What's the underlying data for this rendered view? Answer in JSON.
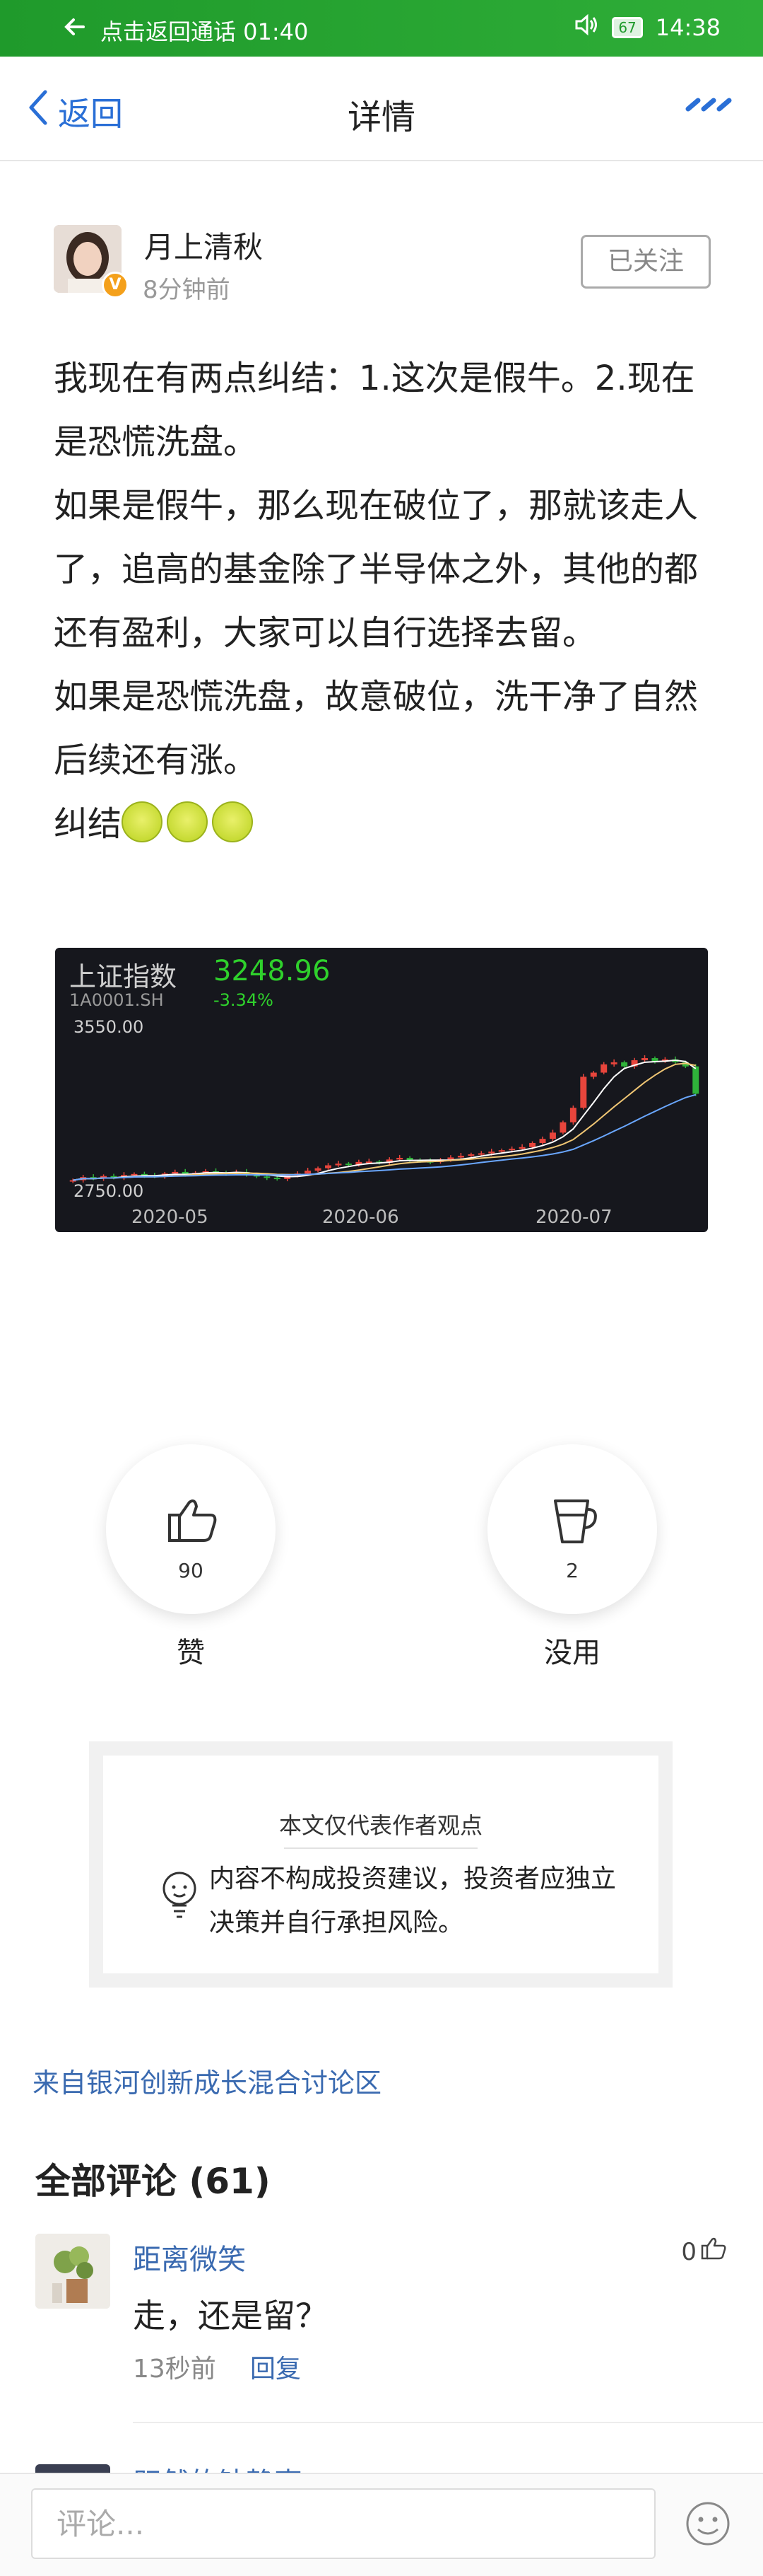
{
  "status_bar": {
    "call_text": "点击返回通话 01:40",
    "battery": "67",
    "time": "14:38"
  },
  "nav": {
    "back_label": "返回",
    "title": "详情"
  },
  "author": {
    "name": "月上清秋",
    "time": "8分钟前",
    "follow_label": "已关注",
    "badge": "V"
  },
  "article": {
    "paragraphs": [
      "我现在有两点纠结：1.这次是假牛。2.现在是恐慌洗盘。",
      "如果是假牛，那么现在破位了，那就该走人了，追高的基金除了半导体之外，其他的都还有盈利，大家可以自行选择去留。",
      "如果是恐慌洗盘，故意破位，洗干净了自然后续还有涨。",
      "纠结"
    ]
  },
  "chart_data": {
    "type": "candlestick",
    "index_name": "上证指数",
    "index_code": "1A0001.SH",
    "price": "3248.96",
    "change": "-3.34%",
    "ylim": [
      2750,
      3550
    ],
    "y_labels": [
      "3550.00",
      "2750.00"
    ],
    "x_labels": [
      "2020-05",
      "2020-06",
      "2020-07"
    ],
    "close": [
      2830,
      2845,
      2838,
      2850,
      2842,
      2855,
      2860,
      2852,
      2848,
      2862,
      2870,
      2858,
      2866,
      2873,
      2868,
      2862,
      2870,
      2858,
      2848,
      2842,
      2836,
      2852,
      2862,
      2876,
      2888,
      2902,
      2910,
      2904,
      2918,
      2920,
      2914,
      2930,
      2938,
      2926,
      2922,
      2918,
      2930,
      2940,
      2948,
      2955,
      2960,
      2968,
      2975,
      2982,
      2990,
      3010,
      3030,
      3060,
      3110,
      3180,
      3330,
      3350,
      3390,
      3400,
      3380,
      3410,
      3420,
      3405,
      3414,
      3400,
      3380,
      3248
    ],
    "colors": {
      "up": "#e8453c",
      "down": "#2fb33a",
      "ma5": "#ffffff",
      "ma10": "#f0c674",
      "ma20": "#6aa7ff"
    }
  },
  "reactions": {
    "like": {
      "count": "90",
      "label": "赞"
    },
    "useless": {
      "count": "2",
      "label": "没用"
    }
  },
  "disclaimer": {
    "title": "本文仅代表作者观点",
    "body": "内容不构成投资建议，投资者应独立决策并自行承担风险。"
  },
  "source_link": "来自银河创新成长混合讨论区",
  "comments": {
    "title": "全部评论 (61)",
    "items": [
      {
        "name": "距离微笑",
        "likes": "0",
        "text": "走，还是留？",
        "time": "13秒前",
        "reply": "回复"
      },
      {
        "name": "既然的钻静声"
      }
    ]
  },
  "bottom": {
    "placeholder": "评论..."
  }
}
